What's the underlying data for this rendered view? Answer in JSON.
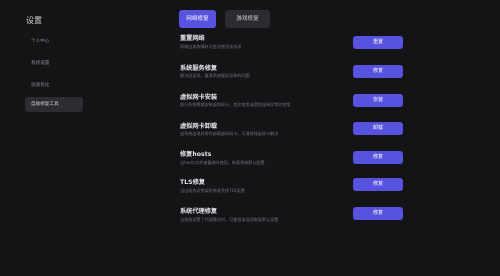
{
  "sidebar": {
    "title": "设置",
    "items": [
      {
        "label": "个人中心"
      },
      {
        "label": "系统设置"
      },
      {
        "label": "加速优化"
      },
      {
        "label": "自助修复工具"
      }
    ]
  },
  "tabs": [
    {
      "label": "网络修复"
    },
    {
      "label": "游戏修复"
    }
  ],
  "repairs": [
    {
      "title": "重置网络",
      "desc": "网络出现故障时可尝试使用该选项",
      "button": "重置"
    },
    {
      "title": "系统服务修复",
      "desc": "解决因误关、篡改系统服务导致的问题",
      "button": "修复"
    },
    {
      "title": "虚拟网卡安装",
      "desc": "部分系统需要安装虚拟网卡，首次使用或遇到连接异常时使用",
      "button": "安装"
    },
    {
      "title": "虚拟网卡卸载",
      "desc": "当系统出现异常时卸载虚拟网卡，可清除残留网卡解决",
      "button": "卸载"
    },
    {
      "title": "修复hosts",
      "desc": "当hosts文件被篡改时使用，恢复系统默认配置",
      "button": "修复"
    },
    {
      "title": "TLS修复",
      "desc": "当出现协议错误时修复系统TLS设置",
      "button": "修复"
    },
    {
      "title": "系统代理修复",
      "desc": "当系统设置了代理模式时，可使用该选项恢复默认设置",
      "button": "修复"
    }
  ]
}
